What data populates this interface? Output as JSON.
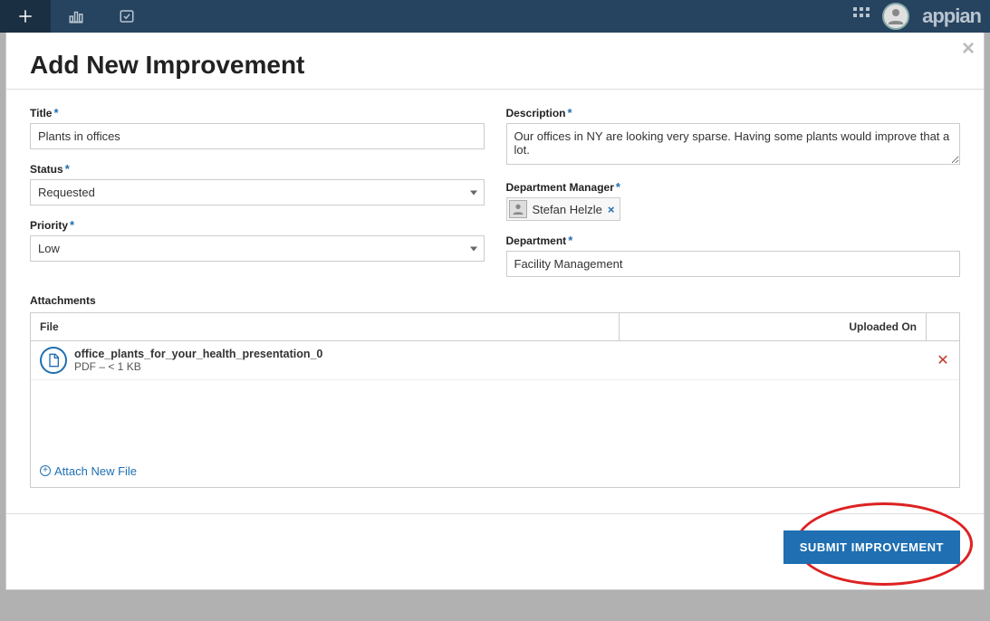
{
  "topbar": {
    "brand": "appian"
  },
  "modal": {
    "title": "Add New Improvement",
    "labels": {
      "title": "Title",
      "status": "Status",
      "priority": "Priority",
      "description": "Description",
      "dept_manager": "Department Manager",
      "department": "Department",
      "attachments": "Attachments"
    },
    "values": {
      "title": "Plants in offices",
      "status": "Requested",
      "priority": "Low",
      "description": "Our offices in NY are looking very sparse. Having some plants would improve that a lot.",
      "manager_name": "Stefan Helzle",
      "department": "Facility Management"
    },
    "attachments": {
      "columns": {
        "file": "File",
        "uploaded": "Uploaded On"
      },
      "rows": [
        {
          "name": "office_plants_for_your_health_presentation_0",
          "meta": "PDF – < 1 KB",
          "uploaded": ""
        }
      ],
      "add_label": "Attach New File"
    },
    "submit_label": "SUBMIT IMPROVEMENT"
  }
}
